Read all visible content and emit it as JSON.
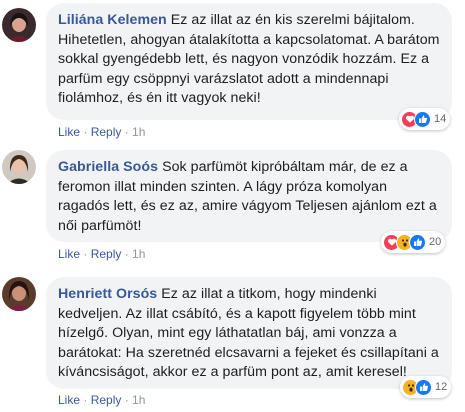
{
  "comments": [
    {
      "author": "Liliána Kelemen",
      "text": "Ez az illat az én kis szerelmi bájitalom. Hihetetlen, ahogyan átalakította a kapcsolatomat. A barátom sokkal gyengédebb lett, és nagyon vonzódik hozzám. Ez a parfüm egy csöppnyi varázslatot adott a mindennapi fiolámhoz, és én itt vagyok neki!",
      "reactions": [
        "love-icon",
        "like-icon"
      ],
      "reaction_count": "14",
      "like_label": "Like",
      "reply_label": "Reply",
      "time": "1h"
    },
    {
      "author": "Gabriella Soós",
      "text": "Sok parfümöt kipróbáltam már, de ez a feromon illat minden szinten. A lágy próza komolyan ragadós lett, és ez az, amire vágyom Teljesen ajánlom ezt a női parfümöt!",
      "reactions": [
        "love-icon",
        "wow-icon",
        "like-icon"
      ],
      "reaction_count": "20",
      "like_label": "Like",
      "reply_label": "Reply",
      "time": "1h"
    },
    {
      "author": "Henriett Orsós",
      "text": "Ez az illat a titkom, hogy mindenki kedveljen. Az illat csábító, és a kapott figyelem több mint hízelgő. Olyan, mint egy láthatatlan báj, ami vonzza a barátokat: Ha szeretnéd elcsavarni a fejeket és csillapítani a kíváncsiságot, akkor ez a parfüm pont az, amit keresel!",
      "reactions": [
        "wow-icon",
        "like-icon"
      ],
      "reaction_count": "12",
      "like_label": "Like",
      "reply_label": "Reply",
      "time": "1h"
    }
  ],
  "colors": {
    "author": "#385898",
    "bubble": "#f2f3f5",
    "like": "#1877f2",
    "love": "#f33e58",
    "wow": "#f7b125",
    "meta": "#90949c"
  }
}
